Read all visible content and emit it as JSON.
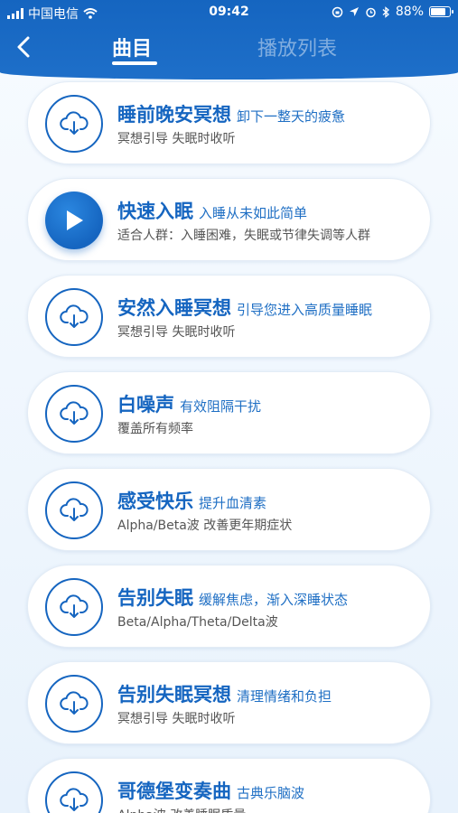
{
  "status_bar": {
    "carrier": "中国电信",
    "time": "09:42",
    "battery": "88%",
    "battery_level": 0.88
  },
  "header": {
    "tabs": [
      {
        "label": "曲目",
        "active": true
      },
      {
        "label": "播放列表",
        "active": false
      }
    ]
  },
  "tracks": [
    {
      "title": "睡前晚安冥想",
      "subtitle": "卸下一整天的疲惫",
      "desc": "冥想引导  失眠时收听",
      "icon": "cloud-download-icon"
    },
    {
      "title": "快速入眠",
      "subtitle": "入睡从未如此简单",
      "desc": "适合人群：入睡困难，失眠或节律失调等人群",
      "icon": "play-icon"
    },
    {
      "title": "安然入睡冥想",
      "subtitle": "引导您进入高质量睡眠",
      "desc": "冥想引导  失眠时收听",
      "icon": "cloud-download-icon"
    },
    {
      "title": "白噪声",
      "subtitle": "有效阻隔干扰",
      "desc": "覆盖所有频率",
      "icon": "cloud-download-icon"
    },
    {
      "title": "感受快乐",
      "subtitle": "提升血清素",
      "desc": "Alpha/Beta波  改善更年期症状",
      "icon": "cloud-download-icon"
    },
    {
      "title": "告别失眠",
      "subtitle": "缓解焦虑，渐入深睡状态",
      "desc": "Beta/Alpha/Theta/Delta波",
      "icon": "cloud-download-icon"
    },
    {
      "title": "告别失眠冥想",
      "subtitle": "清理情绪和负担",
      "desc": "冥想引导  失眠时收听",
      "icon": "cloud-download-icon"
    },
    {
      "title": "哥德堡变奏曲",
      "subtitle": "古典乐脑波",
      "desc": "Alpha波  改善睡眠质量",
      "icon": "cloud-download-icon"
    }
  ],
  "colors": {
    "primary": "#1565c0",
    "subtitle": "#1f6fc4",
    "desc": "#555555"
  }
}
